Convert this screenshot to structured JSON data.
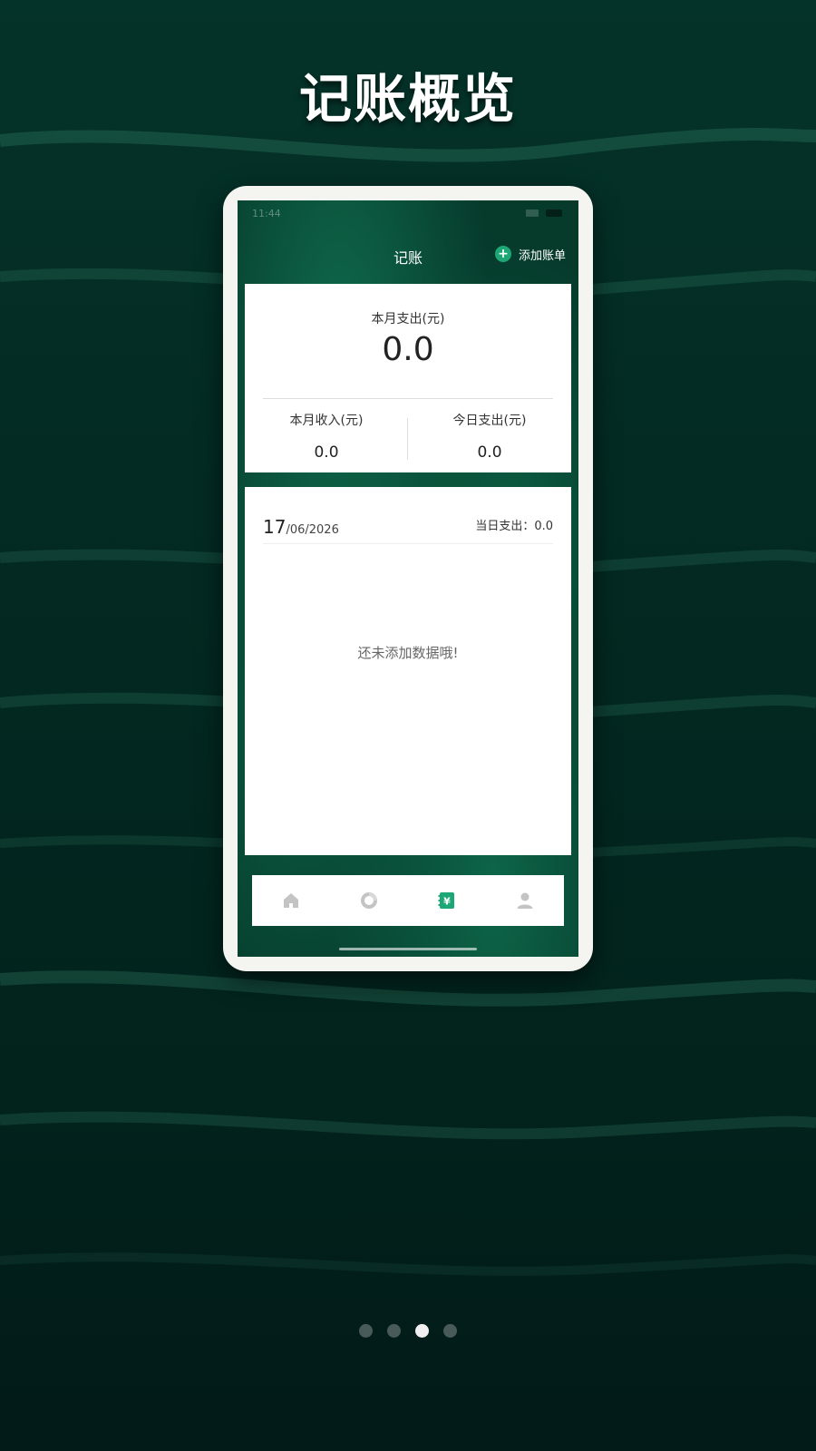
{
  "page": {
    "title": "记账概览"
  },
  "phone": {
    "status_time": "11:44",
    "header": {
      "title": "记账",
      "add_bill_label": "添加账单"
    },
    "summary": {
      "month_expense_label": "本月支出(元)",
      "month_expense_value": "0.0",
      "month_income_label": "本月收入(元)",
      "month_income_value": "0.0",
      "today_expense_label": "今日支出(元)",
      "today_expense_value": "0.0"
    },
    "list": {
      "date_day": "17",
      "date_rest": "/06/2026",
      "day_expense": "当日支出：0.0",
      "empty_text": "还未添加数据哦!"
    },
    "bottom_nav": [
      {
        "icon": "home-icon"
      },
      {
        "icon": "chart-icon"
      },
      {
        "icon": "ledger-icon",
        "active": true
      },
      {
        "icon": "user-icon"
      }
    ]
  },
  "pager": {
    "count": 4,
    "active_index": 2
  },
  "colors": {
    "accent": "#1ea776",
    "nav_active": "#1ea776",
    "nav_inactive": "#c4c4c4"
  }
}
